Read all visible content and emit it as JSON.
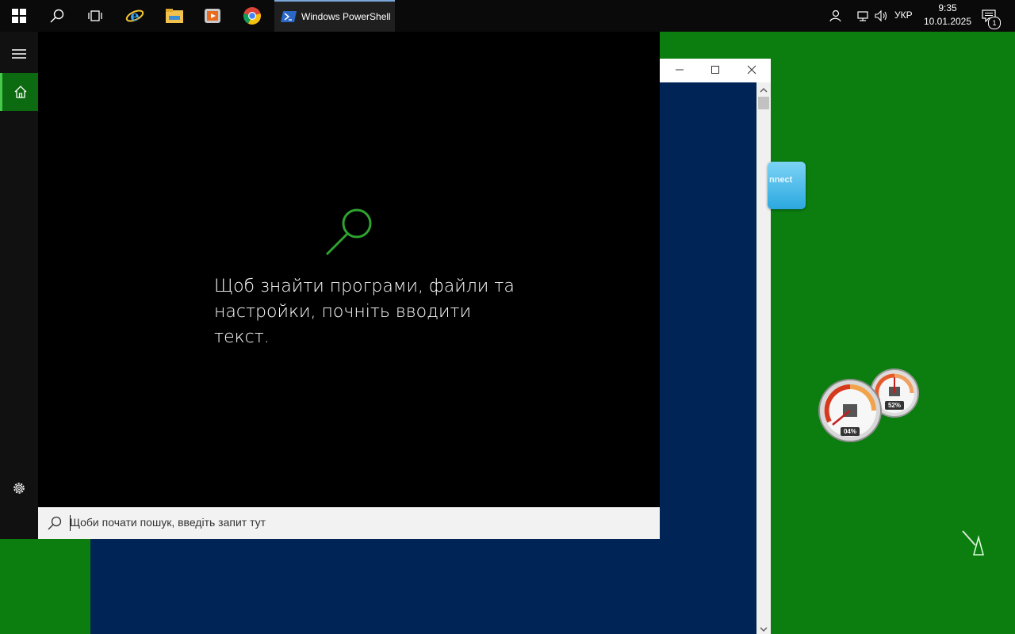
{
  "taskbar": {
    "start_icon": "windows-logo-icon",
    "pinned": [
      {
        "name": "search-icon"
      },
      {
        "name": "task-view-icon"
      },
      {
        "name": "internet-explorer-icon"
      },
      {
        "name": "file-explorer-icon"
      },
      {
        "name": "media-player-icon"
      },
      {
        "name": "chrome-icon"
      }
    ],
    "running_app": {
      "icon": "powershell-icon",
      "label": "Windows PowerShell"
    },
    "tray": {
      "language": "УКР",
      "time": "9:35",
      "date": "10.01.2025",
      "notification_count": "1"
    }
  },
  "start_rail": {
    "items": [
      "hamburger-icon",
      "home-icon",
      "settings-icon"
    ]
  },
  "search": {
    "hint": "Щоб знайти програми, файли та настройки, почніть вводити текст.",
    "placeholder": "Щоби почати пошук, введіть запит тут"
  },
  "desktop": {
    "widget_connect_label": "nnect",
    "gauges": [
      {
        "name": "cpu-gauge",
        "label": "04%",
        "value": 4
      },
      {
        "name": "memory-gauge",
        "label": "52%",
        "value": 52
      }
    ]
  },
  "colors": {
    "desktop": "#0c7d0f",
    "accent": "#46c84a",
    "powershell_bg": "#012456"
  }
}
